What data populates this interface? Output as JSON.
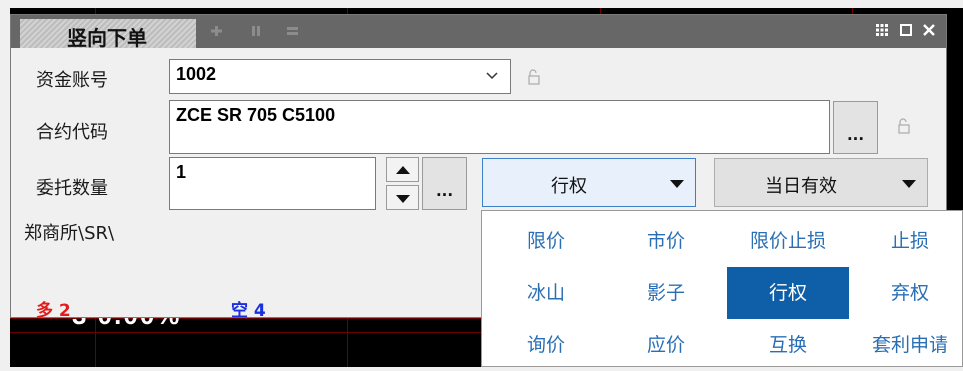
{
  "window": {
    "title": "竖向下单",
    "controls": [
      "grid-icon",
      "maximize-icon",
      "close-icon"
    ]
  },
  "form": {
    "account": {
      "label": "资金账号",
      "value": "1002"
    },
    "contract": {
      "label": "合约代码",
      "value": "ZCE SR 705 C5100",
      "button_label": "..."
    },
    "quantity": {
      "label": "委托数量",
      "value": "1",
      "button_label": "..."
    },
    "order_type": {
      "value": "行权"
    },
    "validity": {
      "value": "当日有效"
    },
    "exchange_path": "郑商所\\SR\\"
  },
  "positions": {
    "long": {
      "label": "多",
      "value": "2",
      "color": "#e31b1b"
    },
    "short": {
      "label": "空",
      "value": "4",
      "color": "#1a2fe0"
    }
  },
  "order_type_menu": {
    "selected": "行权",
    "rows": [
      [
        "限价",
        "市价",
        "限价止损",
        "止损"
      ],
      [
        "冰山",
        "影子",
        "行权",
        "弃权"
      ],
      [
        "询价",
        "应价",
        "互换",
        "套利申请"
      ]
    ]
  },
  "background": {
    "digits": "3 0.00%"
  },
  "colors": {
    "accent": "#0f5fa8",
    "menu_text": "#2a6fb5",
    "titlebar": "#676767"
  }
}
